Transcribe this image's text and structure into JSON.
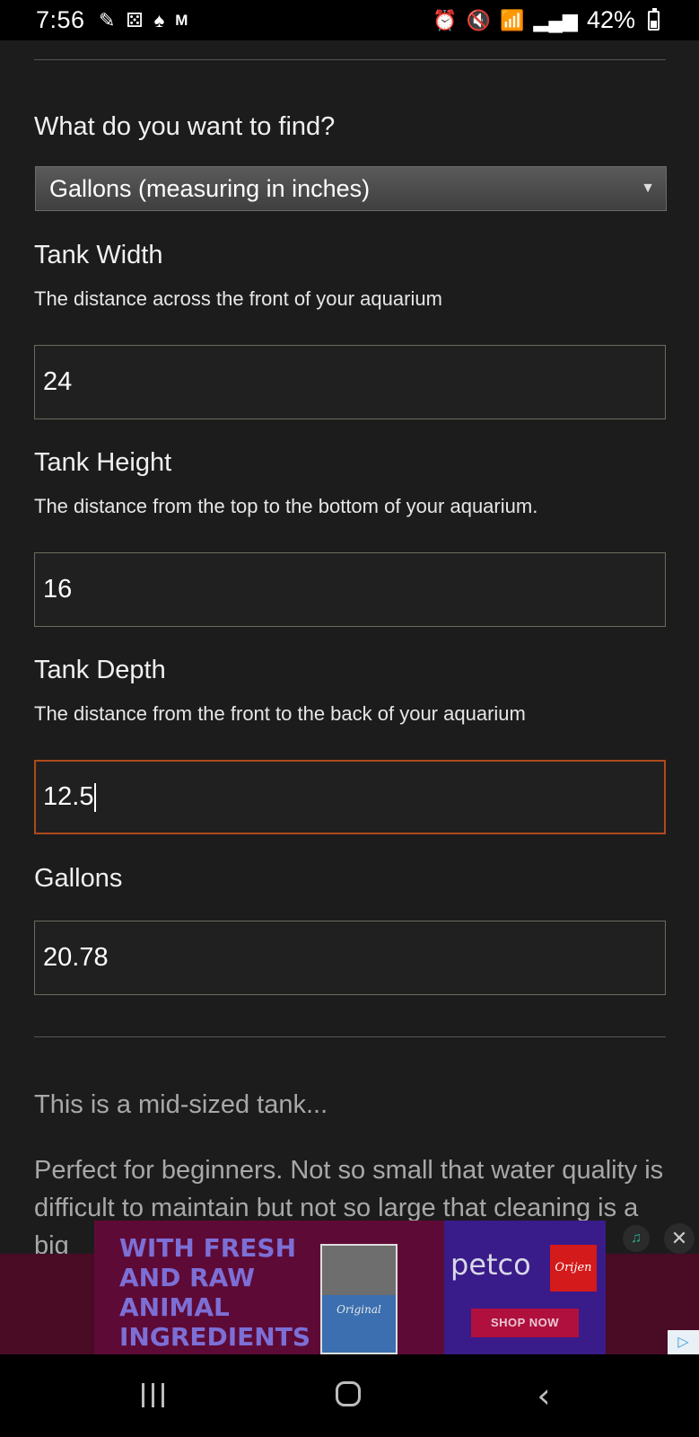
{
  "status_bar": {
    "time": "7:56",
    "left_icons": [
      "pencil-icon",
      "game-icon",
      "card-icon",
      "gmail-icon"
    ],
    "battery": "42%"
  },
  "form": {
    "find_label": "What do you want to find?",
    "find_select_value": "Gallons (measuring in inches)",
    "width": {
      "label": "Tank Width",
      "description": "The distance across the front of your aquarium",
      "value": "24"
    },
    "height": {
      "label": "Tank Height",
      "description": "The distance from the top to the bottom of your aquarium.",
      "value": "16"
    },
    "depth": {
      "label": "Tank Depth",
      "description": "The distance from the front to the back of your aquarium",
      "value": "12.5"
    },
    "result": {
      "label": "Gallons",
      "value": "20.78"
    }
  },
  "summary": {
    "heading": "This is a mid-sized tank...",
    "body": "Perfect for beginners. Not so small that water quality is difficult to maintain but not so large that cleaning is a big"
  },
  "ad": {
    "headline_lines": [
      "WITH FRESH",
      "AND RAW",
      "ANIMAL",
      "INGREDIENTS"
    ],
    "bag_text": "Original",
    "brand": "petco",
    "partner": "Orijen",
    "cta": "SHOP NOW"
  }
}
